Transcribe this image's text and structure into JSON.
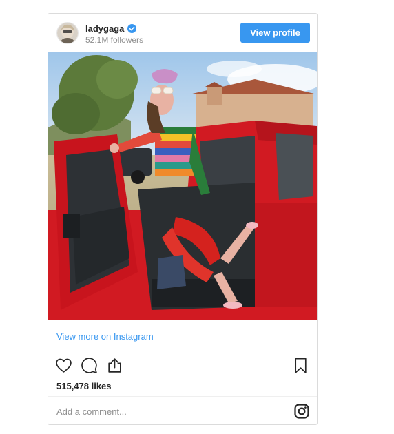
{
  "post": {
    "username": "ladygaga",
    "followers": "52.1M followers",
    "view_profile_label": "View profile",
    "view_more_label": "View more on Instagram",
    "likes": "515,478 likes",
    "comment_placeholder": "Add a comment...",
    "verified": true
  },
  "colors": {
    "accent": "#3897f0",
    "border": "#dbdbdb",
    "text": "#262626",
    "muted": "#8e8e8e"
  },
  "icons": {
    "like": "heart-icon",
    "comment": "comment-icon",
    "share": "share-icon",
    "save": "bookmark-icon",
    "brand": "instagram-icon",
    "verified": "verified-badge-icon"
  }
}
